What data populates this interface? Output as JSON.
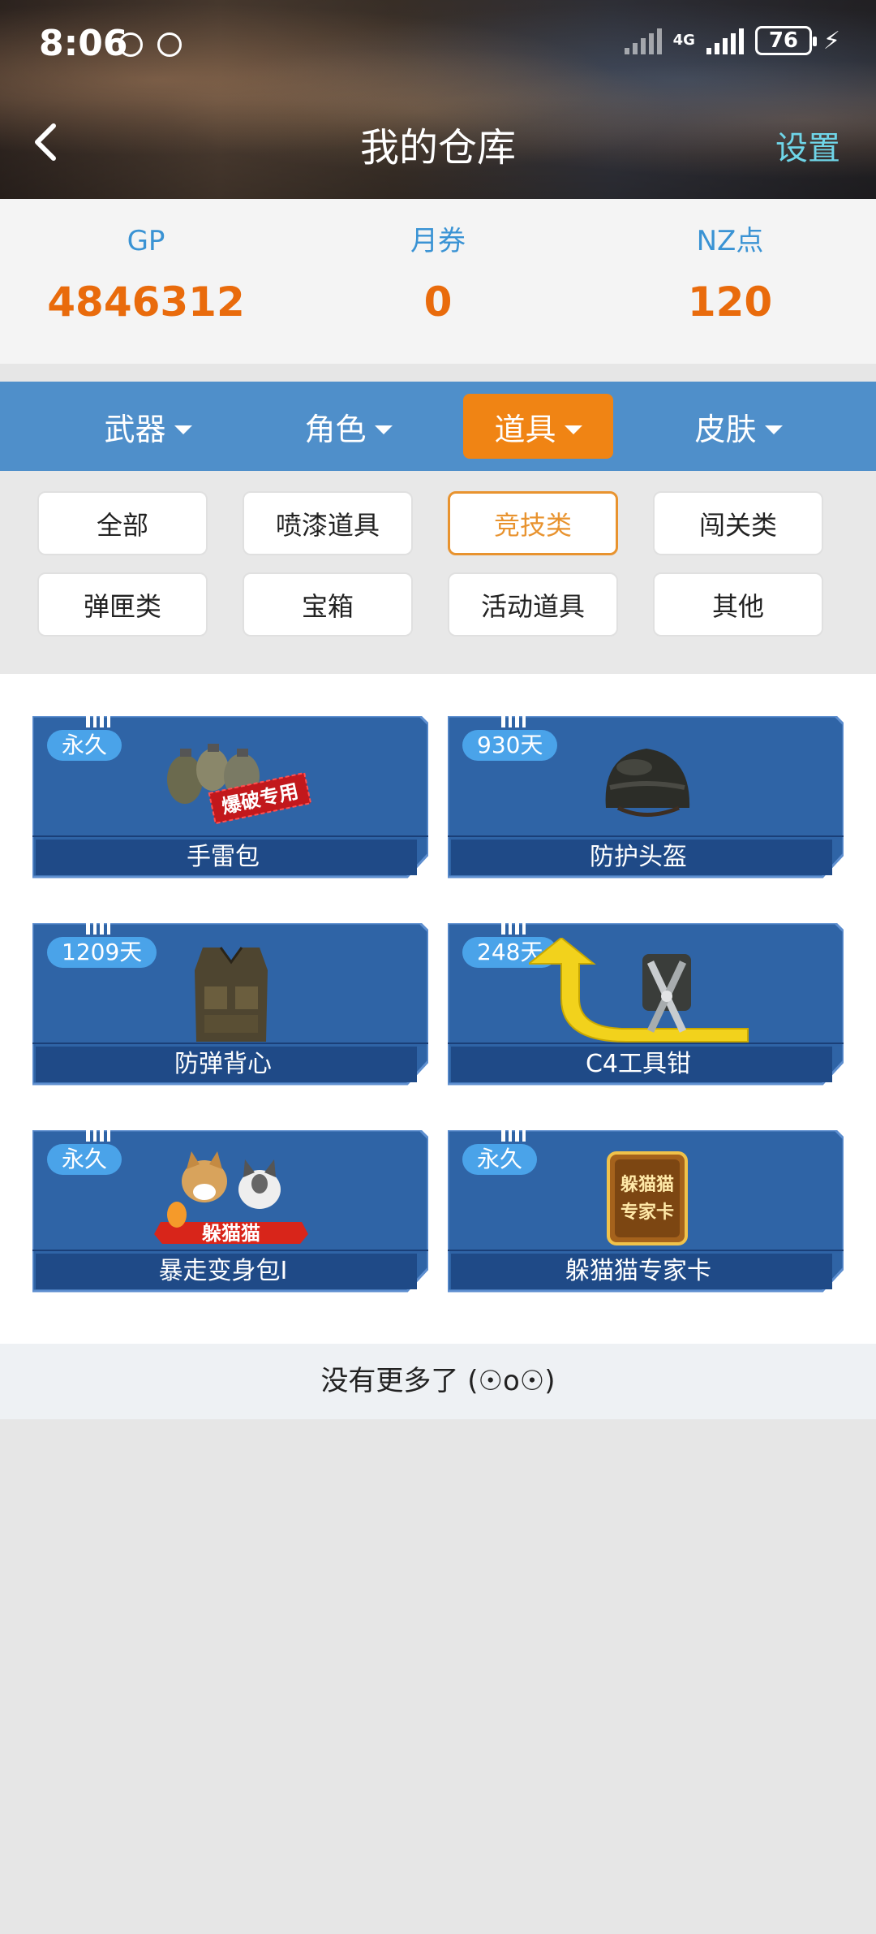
{
  "status_bar": {
    "time": "8:06",
    "network_label": "4G",
    "battery": "76"
  },
  "nav": {
    "title": "我的仓库",
    "settings_label": "设置"
  },
  "currency": [
    {
      "label": "GP",
      "value": "4846312"
    },
    {
      "label": "月券",
      "value": "0"
    },
    {
      "label": "NZ点",
      "value": "120"
    }
  ],
  "category_tabs": [
    {
      "label": "武器",
      "active": false
    },
    {
      "label": "角色",
      "active": false
    },
    {
      "label": "道具",
      "active": true
    },
    {
      "label": "皮肤",
      "active": false
    }
  ],
  "filters": [
    {
      "label": "全部",
      "active": false
    },
    {
      "label": "喷漆道具",
      "active": false
    },
    {
      "label": "竞技类",
      "active": true
    },
    {
      "label": "闯关类",
      "active": false
    },
    {
      "label": "弹匣类",
      "active": false
    },
    {
      "label": "宝箱",
      "active": false
    },
    {
      "label": "活动道具",
      "active": false
    },
    {
      "label": "其他",
      "active": false
    }
  ],
  "items": [
    {
      "name": "手雷包",
      "duration": "永久",
      "icon": "grenade-pack-icon"
    },
    {
      "name": "防护头盔",
      "duration": "930天",
      "icon": "helmet-icon"
    },
    {
      "name": "防弹背心",
      "duration": "1209天",
      "icon": "vest-icon"
    },
    {
      "name": "C4工具钳",
      "duration": "248天",
      "icon": "pliers-icon"
    },
    {
      "name": "暴走变身包I",
      "duration": "永久",
      "icon": "pets-icon"
    },
    {
      "name": "躲猫猫专家卡",
      "duration": "永久",
      "icon": "expert-card-icon"
    }
  ],
  "item_icon_texts": {
    "grenade_stamp": "爆破专用",
    "pets_banner": "躲猫猫",
    "card_line1": "躲猫猫",
    "card_line2": "专家卡"
  },
  "footer": {
    "no_more_text": "没有更多了 (☉o☉)"
  },
  "colors": {
    "accent_orange": "#f08414",
    "value_orange": "#e96b0c",
    "label_blue": "#3a93d4",
    "tab_bar_blue": "#4f8fca",
    "badge_blue": "#4aa3e9",
    "settings_cyan": "#6fd5e8"
  }
}
